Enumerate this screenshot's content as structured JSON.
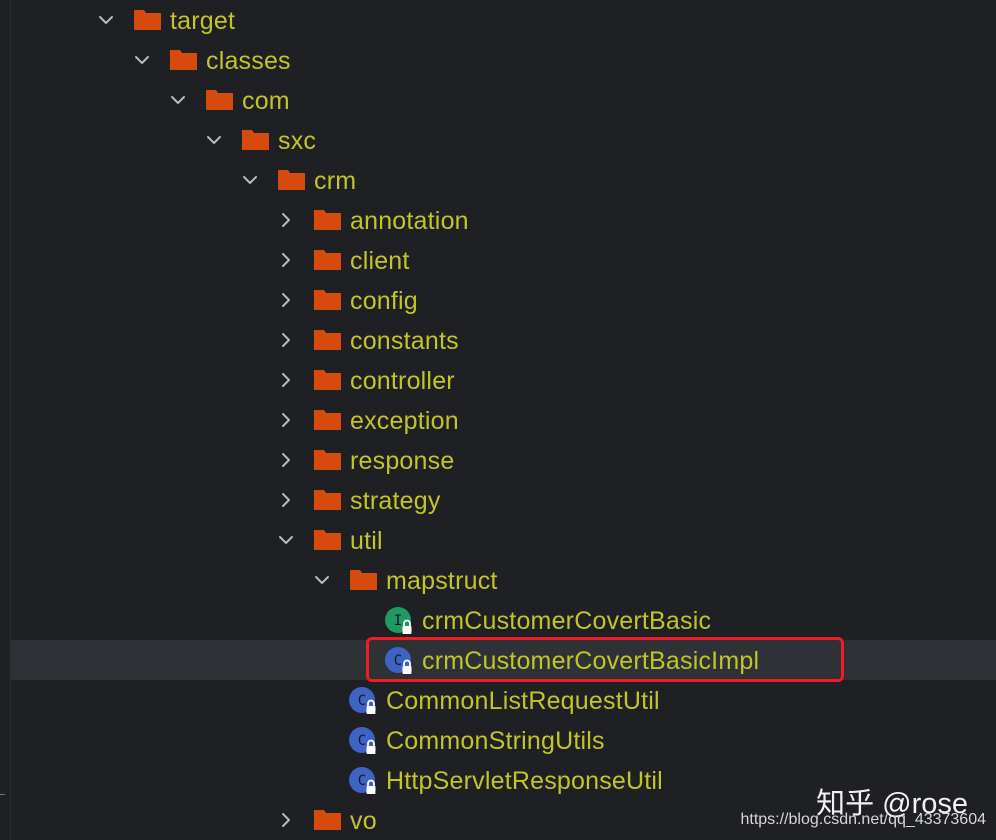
{
  "tree": {
    "nodes": [
      {
        "name": "tree-node-target",
        "label": "target",
        "type": "folder",
        "expanded": true
      },
      {
        "name": "tree-node-classes",
        "label": "classes",
        "type": "folder",
        "expanded": true
      },
      {
        "name": "tree-node-com",
        "label": "com",
        "type": "folder",
        "expanded": true
      },
      {
        "name": "tree-node-sxc",
        "label": "sxc",
        "type": "folder",
        "expanded": true
      },
      {
        "name": "tree-node-crm",
        "label": "crm",
        "type": "folder",
        "expanded": true
      },
      {
        "name": "tree-node-annotation",
        "label": "annotation",
        "type": "folder",
        "expanded": false
      },
      {
        "name": "tree-node-client",
        "label": "client",
        "type": "folder",
        "expanded": false
      },
      {
        "name": "tree-node-config",
        "label": "config",
        "type": "folder",
        "expanded": false
      },
      {
        "name": "tree-node-constants",
        "label": "constants",
        "type": "folder",
        "expanded": false
      },
      {
        "name": "tree-node-controller",
        "label": "controller",
        "type": "folder",
        "expanded": false
      },
      {
        "name": "tree-node-exception",
        "label": "exception",
        "type": "folder",
        "expanded": false
      },
      {
        "name": "tree-node-response",
        "label": "response",
        "type": "folder",
        "expanded": false
      },
      {
        "name": "tree-node-strategy",
        "label": "strategy",
        "type": "folder",
        "expanded": false
      },
      {
        "name": "tree-node-util",
        "label": "util",
        "type": "folder",
        "expanded": true
      },
      {
        "name": "tree-node-mapstruct",
        "label": "mapstruct",
        "type": "folder",
        "expanded": true
      },
      {
        "name": "tree-node-crmcustomercovertbasic",
        "label": "crmCustomerCovertBasic",
        "type": "interface",
        "icon_letter": "I"
      },
      {
        "name": "tree-node-crmcustomercovertbasicimpl",
        "label": "crmCustomerCovertBasicImpl",
        "type": "class",
        "icon_letter": "C",
        "selected": true,
        "highlighted": true
      },
      {
        "name": "tree-node-commonlistrequestutil",
        "label": "CommonListRequestUtil",
        "type": "class",
        "icon_letter": "C"
      },
      {
        "name": "tree-node-commonstringutils",
        "label": "CommonStringUtils",
        "type": "class",
        "icon_letter": "C"
      },
      {
        "name": "tree-node-httpservletresponseutil",
        "label": "HttpServletResponseUtil",
        "type": "class",
        "icon_letter": "C"
      },
      {
        "name": "tree-node-vo",
        "label": "vo",
        "type": "folder",
        "expanded": false
      }
    ]
  },
  "icons": {
    "folder": "folder-icon",
    "interface": "interface-icon",
    "class": "class-icon",
    "lock": "lock-icon",
    "chevron_expanded": "chevron-down-icon",
    "chevron_collapsed": "chevron-right-icon"
  },
  "colors": {
    "background": "#1f2023",
    "label": "#c2c428",
    "folder": "#d64a0e",
    "interface_icon": "#1f9a63",
    "class_icon": "#3f63c4",
    "selection": "#2e3136",
    "highlight_box": "#ee1c25"
  },
  "watermark": {
    "main": "知乎 @rose",
    "url": "https://blog.csdn.net/qq_43373604"
  }
}
